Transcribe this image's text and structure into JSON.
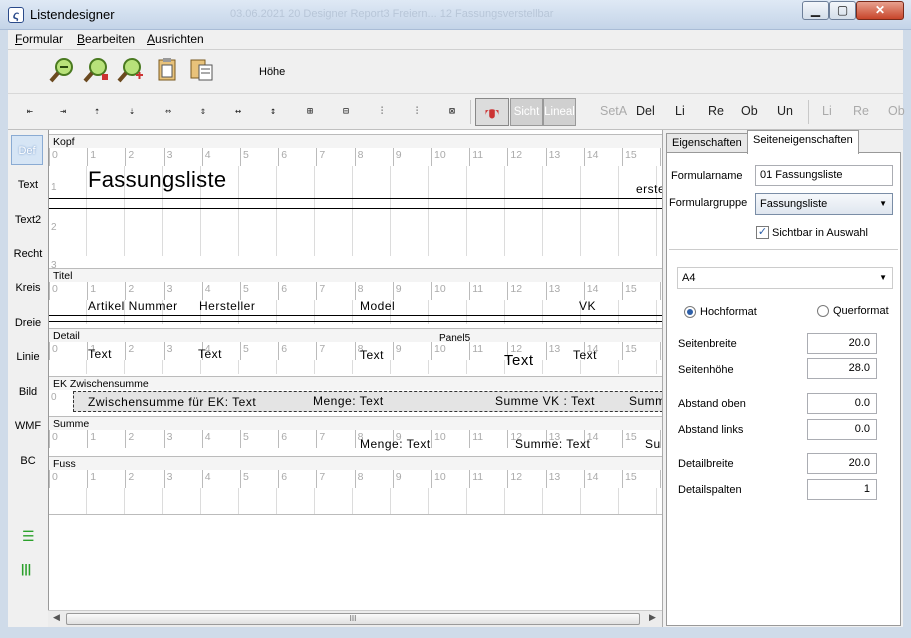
{
  "window": {
    "title": "Listendesigner",
    "ghost_text": "03.06.2021 20     Designer Report3     Freiern...   12 Fassungsverstellbar"
  },
  "menu": [
    "Formular",
    "Bearbeiten",
    "Ausrichten"
  ],
  "toolbar1": {
    "height_label": "Höhe"
  },
  "toolbar2": {
    "toggle_sicht": "Sicht",
    "toggle_lineal": "Lineal",
    "buttons": [
      "SetA",
      "Del",
      "Li",
      "Re",
      "Ob",
      "Un",
      "Li",
      "Re",
      "Ob"
    ]
  },
  "sidebar": [
    "Def",
    "Text",
    "Text2",
    "Recht",
    "Kreis",
    "Dreie",
    "Linie",
    "Bild",
    "WMF",
    "BC"
  ],
  "ruler_numbers": [
    "0",
    "1",
    "2",
    "3",
    "4",
    "5",
    "6",
    "7",
    "8",
    "9",
    "10",
    "11",
    "12",
    "13",
    "14",
    "15",
    "1"
  ],
  "bands": {
    "kopf": {
      "label": "Kopf",
      "title": "Fassungsliste",
      "right_cut": "erste",
      "v1": "1",
      "v2": "2",
      "v3": "3"
    },
    "titel": {
      "label": "Titel",
      "v0": "0",
      "fields": [
        "Artikel Nummer",
        "Hersteller",
        "Model",
        "VK"
      ]
    },
    "detail": {
      "label": "Detail",
      "v0": "0",
      "panel": "Panel5",
      "fields": [
        "Text",
        "Text",
        "Text",
        "Text",
        "Text"
      ]
    },
    "ek": {
      "label": "EK Zwischensumme",
      "v0": "0",
      "fields": [
        "Zwischensumme für EK: Text",
        "Menge: Text",
        "Summe VK : Text",
        "Summ"
      ]
    },
    "summe": {
      "label": "Summe",
      "fields": [
        "Menge:  Text",
        "Summe:  Text",
        "Su"
      ]
    },
    "fuss": {
      "label": "Fuss"
    }
  },
  "panel": {
    "tabs": [
      "Eigenschaften",
      "Seiteneigenschaften"
    ],
    "formularname_label": "Formularname",
    "formularname_value": "01 Fassungsliste",
    "formulargruppe_label": "Formulargruppe",
    "formulargruppe_value": "Fassungsliste",
    "sichtbar_label": "Sichtbar in Auswahl",
    "paper": "A4",
    "hochformat": "Hochformat",
    "querformat": "Querformat",
    "fields": [
      {
        "label": "Seitenbreite",
        "value": "20.0"
      },
      {
        "label": "Seitenhöhe",
        "value": "28.0"
      },
      {
        "label": "Abstand oben",
        "value": "0.0"
      },
      {
        "label": "Abstand links",
        "value": "0.0"
      },
      {
        "label": "Detailbreite",
        "value": "20.0"
      },
      {
        "label": "Detailspalten",
        "value": "1"
      }
    ]
  },
  "colors": {
    "accent": "#2d5fa8",
    "titlebar": "#c4d4e8",
    "close": "#c7452a"
  },
  "scroll": {
    "thumb_grip": "III"
  }
}
